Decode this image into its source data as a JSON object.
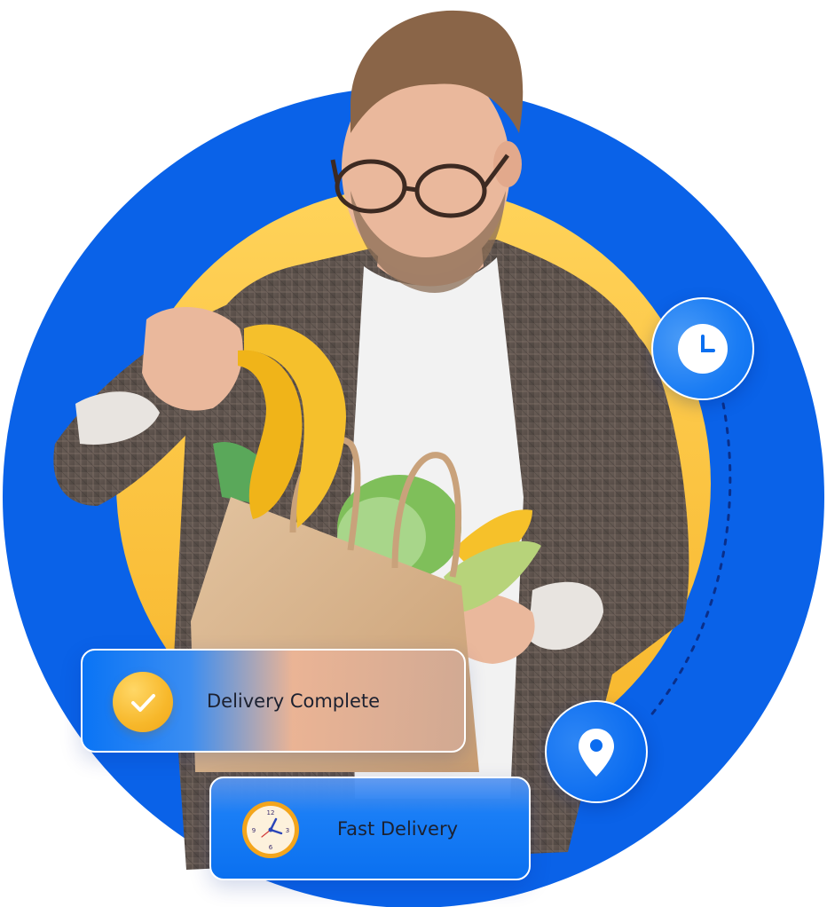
{
  "cards": {
    "complete_label": "Delivery Complete",
    "fast_label": "Fast Delivery"
  },
  "clock_numerals": [
    "12",
    "3",
    "6",
    "9"
  ],
  "icons": {
    "check": "check-icon",
    "alarm_clock": "alarm-clock-icon",
    "clock": "clock-icon",
    "location": "location-pin-icon"
  },
  "colors": {
    "outer_circle": "#0a62e8",
    "inner_circle": "#fbc53e",
    "card_blue": "#0a74f5",
    "check_badge": "#f7b82b",
    "text": "#1c2130"
  }
}
